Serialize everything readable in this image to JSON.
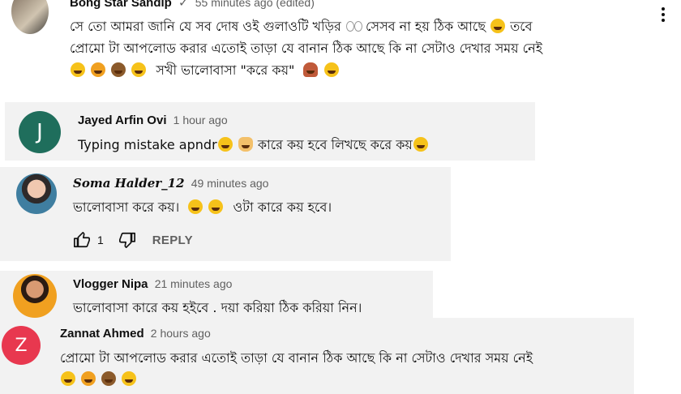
{
  "comments": [
    {
      "author": "Bong Star Sandip",
      "verified": "✓",
      "time": "55 minutes ago (edited)",
      "line1": "সে তো আমরা জানি যে সব দোষ ওই গুলাওটি খড়ির",
      "line1b": "সেসব না হয় ঠিক আছে",
      "line1c": "তবে",
      "line2": "প্রোমো টা আপলোড করার এতোই তাড়া যে বানান ঠিক আছে কি না সেটাও দেখার সময় নেই",
      "line3": "সখী ভালোবাসা \"করে কয়\""
    },
    {
      "author": "Jayed Arfin Ovi",
      "avatar_letter": "J",
      "time": "1 hour ago",
      "text_a": "Typing mistake apndr",
      "text_b": "কারে কয় হবে লিখছে করে কয়"
    },
    {
      "author": "𝑺𝒐𝒎𝒂 𝑯𝒂𝒍𝒅𝒆𝒓_12",
      "time": "49 minutes ago",
      "text_a": "ভালোবাসা করে কয়।",
      "text_b": "ওটা কারে কয় হবে।",
      "likes": "1",
      "reply": "REPLY"
    },
    {
      "author": "Vlogger Nipa",
      "time": "21 minutes ago",
      "text": "ভালোবাসা কারে কয় হইবে . দয়া করিয়া ঠিক করিয়া নিন।"
    },
    {
      "author": "Zannat Ahmed",
      "avatar_letter": "Z",
      "time": "2 hours ago",
      "line1": "প্রোমো টা আপলোড করার এতোই তাড়া যে বানান ঠিক আছে কি না সেটাও দেখার সময় নেই"
    }
  ],
  "colors": {
    "avatar_j": "#1f6e5c",
    "avatar_z": "#e8384f",
    "panel_bg": "#f2f2f2"
  }
}
